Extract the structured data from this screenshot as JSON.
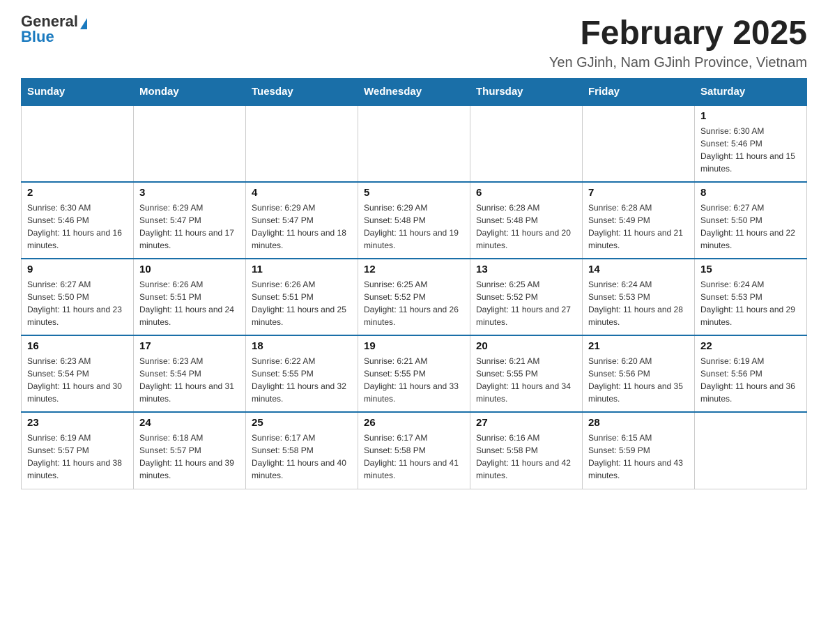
{
  "logo": {
    "text_general": "General",
    "text_blue": "Blue"
  },
  "title": "February 2025",
  "subtitle": "Yen GJinh, Nam GJinh Province, Vietnam",
  "days_of_week": [
    "Sunday",
    "Monday",
    "Tuesday",
    "Wednesday",
    "Thursday",
    "Friday",
    "Saturday"
  ],
  "weeks": [
    [
      {
        "day": "",
        "info": ""
      },
      {
        "day": "",
        "info": ""
      },
      {
        "day": "",
        "info": ""
      },
      {
        "day": "",
        "info": ""
      },
      {
        "day": "",
        "info": ""
      },
      {
        "day": "",
        "info": ""
      },
      {
        "day": "1",
        "info": "Sunrise: 6:30 AM\nSunset: 5:46 PM\nDaylight: 11 hours and 15 minutes."
      }
    ],
    [
      {
        "day": "2",
        "info": "Sunrise: 6:30 AM\nSunset: 5:46 PM\nDaylight: 11 hours and 16 minutes."
      },
      {
        "day": "3",
        "info": "Sunrise: 6:29 AM\nSunset: 5:47 PM\nDaylight: 11 hours and 17 minutes."
      },
      {
        "day": "4",
        "info": "Sunrise: 6:29 AM\nSunset: 5:47 PM\nDaylight: 11 hours and 18 minutes."
      },
      {
        "day": "5",
        "info": "Sunrise: 6:29 AM\nSunset: 5:48 PM\nDaylight: 11 hours and 19 minutes."
      },
      {
        "day": "6",
        "info": "Sunrise: 6:28 AM\nSunset: 5:48 PM\nDaylight: 11 hours and 20 minutes."
      },
      {
        "day": "7",
        "info": "Sunrise: 6:28 AM\nSunset: 5:49 PM\nDaylight: 11 hours and 21 minutes."
      },
      {
        "day": "8",
        "info": "Sunrise: 6:27 AM\nSunset: 5:50 PM\nDaylight: 11 hours and 22 minutes."
      }
    ],
    [
      {
        "day": "9",
        "info": "Sunrise: 6:27 AM\nSunset: 5:50 PM\nDaylight: 11 hours and 23 minutes."
      },
      {
        "day": "10",
        "info": "Sunrise: 6:26 AM\nSunset: 5:51 PM\nDaylight: 11 hours and 24 minutes."
      },
      {
        "day": "11",
        "info": "Sunrise: 6:26 AM\nSunset: 5:51 PM\nDaylight: 11 hours and 25 minutes."
      },
      {
        "day": "12",
        "info": "Sunrise: 6:25 AM\nSunset: 5:52 PM\nDaylight: 11 hours and 26 minutes."
      },
      {
        "day": "13",
        "info": "Sunrise: 6:25 AM\nSunset: 5:52 PM\nDaylight: 11 hours and 27 minutes."
      },
      {
        "day": "14",
        "info": "Sunrise: 6:24 AM\nSunset: 5:53 PM\nDaylight: 11 hours and 28 minutes."
      },
      {
        "day": "15",
        "info": "Sunrise: 6:24 AM\nSunset: 5:53 PM\nDaylight: 11 hours and 29 minutes."
      }
    ],
    [
      {
        "day": "16",
        "info": "Sunrise: 6:23 AM\nSunset: 5:54 PM\nDaylight: 11 hours and 30 minutes."
      },
      {
        "day": "17",
        "info": "Sunrise: 6:23 AM\nSunset: 5:54 PM\nDaylight: 11 hours and 31 minutes."
      },
      {
        "day": "18",
        "info": "Sunrise: 6:22 AM\nSunset: 5:55 PM\nDaylight: 11 hours and 32 minutes."
      },
      {
        "day": "19",
        "info": "Sunrise: 6:21 AM\nSunset: 5:55 PM\nDaylight: 11 hours and 33 minutes."
      },
      {
        "day": "20",
        "info": "Sunrise: 6:21 AM\nSunset: 5:55 PM\nDaylight: 11 hours and 34 minutes."
      },
      {
        "day": "21",
        "info": "Sunrise: 6:20 AM\nSunset: 5:56 PM\nDaylight: 11 hours and 35 minutes."
      },
      {
        "day": "22",
        "info": "Sunrise: 6:19 AM\nSunset: 5:56 PM\nDaylight: 11 hours and 36 minutes."
      }
    ],
    [
      {
        "day": "23",
        "info": "Sunrise: 6:19 AM\nSunset: 5:57 PM\nDaylight: 11 hours and 38 minutes."
      },
      {
        "day": "24",
        "info": "Sunrise: 6:18 AM\nSunset: 5:57 PM\nDaylight: 11 hours and 39 minutes."
      },
      {
        "day": "25",
        "info": "Sunrise: 6:17 AM\nSunset: 5:58 PM\nDaylight: 11 hours and 40 minutes."
      },
      {
        "day": "26",
        "info": "Sunrise: 6:17 AM\nSunset: 5:58 PM\nDaylight: 11 hours and 41 minutes."
      },
      {
        "day": "27",
        "info": "Sunrise: 6:16 AM\nSunset: 5:58 PM\nDaylight: 11 hours and 42 minutes."
      },
      {
        "day": "28",
        "info": "Sunrise: 6:15 AM\nSunset: 5:59 PM\nDaylight: 11 hours and 43 minutes."
      },
      {
        "day": "",
        "info": ""
      }
    ]
  ]
}
